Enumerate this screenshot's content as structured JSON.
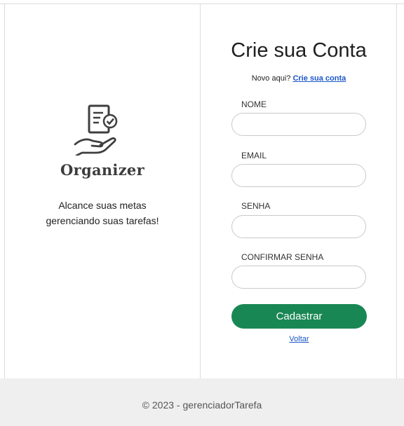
{
  "brand": {
    "name": "Organizer",
    "tagline_line1": "Alcance suas metas",
    "tagline_line2": "gerenciando suas tarefas!"
  },
  "form": {
    "title": "Crie sua Conta",
    "subtitle_prefix": "Novo aqui?",
    "subtitle_link": "Crie sua conta",
    "fields": [
      {
        "label": "NOME",
        "value": "",
        "placeholder": ""
      },
      {
        "label": "EMAIL",
        "value": "",
        "placeholder": ""
      },
      {
        "label": "SENHA",
        "value": "",
        "placeholder": ""
      },
      {
        "label": "CONFIRMAR SENHA",
        "value": "",
        "placeholder": ""
      }
    ],
    "submit_label": "Cadastrar",
    "back_label": "Voltar"
  },
  "footer": {
    "text": "© 2023 - gerenciadorTarefa"
  },
  "colors": {
    "primary_button": "#198754",
    "link": "#1a56c8",
    "footer_bg": "#efefef"
  },
  "icons": {
    "logo": "checklist-hand-icon"
  }
}
